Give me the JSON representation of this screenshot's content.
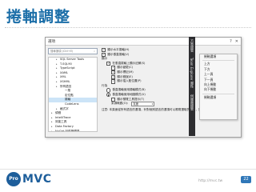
{
  "slide": {
    "title": "捲軸調整",
    "footer_url": "http://mvc.tw",
    "page_number": "22",
    "logo_circle": "Pro",
    "logo_text": "MVC"
  },
  "dialog": {
    "title": "選項",
    "search_placeholder": "搜尋選項 (Ctrl+E)",
    "search_icon": "search-icon",
    "tree": [
      {
        "label": "SQL Server Tools",
        "level": 1,
        "selected": false
      },
      {
        "label": "T-SQL90",
        "level": 1,
        "selected": false
      },
      {
        "label": "TypeScript",
        "level": 1,
        "selected": false
      },
      {
        "label": "XAML",
        "level": 1,
        "selected": false
      },
      {
        "label": "XML",
        "level": 1,
        "selected": false
      },
      {
        "label": "XSHML",
        "level": 1,
        "selected": false
      },
      {
        "label": "所有語言",
        "level": 1,
        "selected": false
      },
      {
        "label": "一般",
        "level": 2,
        "selected": false
      },
      {
        "label": "定位點",
        "level": 2,
        "selected": false
      },
      {
        "label": "捲軸",
        "level": 2,
        "selected": true
      },
      {
        "label": "CodeLens",
        "level": 2,
        "selected": false
      },
      {
        "label": "格式字",
        "level": 1,
        "selected": false
      },
      {
        "label": "偵錯",
        "level": 0,
        "selected": false
      },
      {
        "label": "IntelliTrace",
        "level": 0,
        "selected": false
      },
      {
        "label": "效能工具",
        "level": 0,
        "selected": false
      },
      {
        "label": "Data Factory",
        "level": 0,
        "selected": false
      },
      {
        "label": "NuGet 封裝管理員",
        "level": 0,
        "selected": false
      }
    ],
    "options": [
      {
        "kind": "cb",
        "label": "顯示水平捲軸(H)",
        "checked": true,
        "indent": 0
      },
      {
        "kind": "cb",
        "label": "顯示垂直捲軸(V)",
        "checked": true,
        "indent": 0
      },
      {
        "kind": "text",
        "label": "顯示",
        "indent": 0
      },
      {
        "kind": "cb",
        "label": "在垂直捲軸上顯示註解(S)",
        "checked": true,
        "indent": 1
      },
      {
        "kind": "cb",
        "label": "顯示變更(C)",
        "checked": true,
        "indent": 2
      },
      {
        "kind": "cb",
        "label": "顯示標記(M)",
        "checked": true,
        "indent": 2
      },
      {
        "kind": "cb",
        "label": "顯示錯誤(E)",
        "checked": true,
        "indent": 2
      },
      {
        "kind": "cb",
        "label": "顯示插入點位置(P)",
        "checked": true,
        "indent": 2
      },
      {
        "kind": "text",
        "label": "行為",
        "indent": 0
      },
      {
        "kind": "rb",
        "label": "垂直捲軸使用捲軸模式(B)",
        "checked": false,
        "indent": 1
      },
      {
        "kind": "rb",
        "label": "垂直捲軸使用地圖模式(U)",
        "checked": true,
        "indent": 1
      },
      {
        "kind": "cb",
        "label": "顯示預覽工具提示(T)",
        "checked": false,
        "indent": 2
      },
      {
        "kind": "select",
        "label": "來源概觀(O):",
        "value": "寬度",
        "indent": 2
      }
    ],
    "note": "注意: 本頁面從所有語言的選項，針對個別語言的選項可以覆寫選取的設定，請在左側的捲軸標籤上設定。"
  },
  "side_tabs": [
    "方案總管",
    "Team Explorer",
    "屬性",
    "伺服器總管"
  ],
  "context_menu": [
    "捲軸選項",
    "上方",
    "下方",
    "上一頁",
    "下一頁",
    "向上捲動",
    "向下捲動",
    "捲軸選項"
  ]
}
